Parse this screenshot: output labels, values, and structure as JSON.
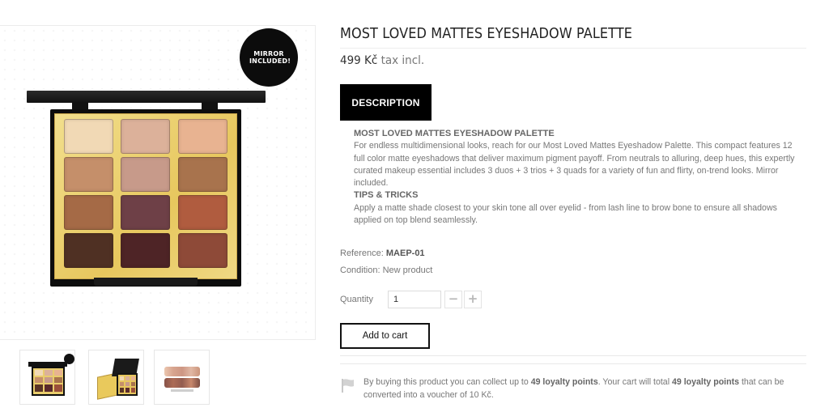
{
  "gallery": {
    "badge_text": "MIRROR INCLUDED!",
    "shade_colors": [
      "#f1d9b5",
      "#dcb19a",
      "#e8b391",
      "#c58f6a",
      "#c79a8a",
      "#a8734d",
      "#a56a46",
      "#6e4047",
      "#b05c3f",
      "#4f3023",
      "#4e2426",
      "#8e4a38"
    ],
    "thumbnails": [
      {
        "name": "thumbnail-palette-open"
      },
      {
        "name": "thumbnail-palette-box"
      },
      {
        "name": "thumbnail-swatches"
      }
    ]
  },
  "product": {
    "title": "MOST LOVED MATTES EYESHADOW PALETTE",
    "price": "499 Kč",
    "tax_label": "tax incl.",
    "tab_label": "DESCRIPTION",
    "description": {
      "heading": "MOST LOVED MATTES EYESHADOW PALETTE",
      "body": "For endless multidimensional looks, reach for our Most Loved Mattes Eyeshadow Palette. This compact features 12 full color matte eyeshadows that deliver maximum pigment payoff. From neutrals to alluring, deep hues, this expertly curated makeup essential includes 3 duos + 3 trios + 3 quads for a variety of fun and flirty, on-trend looks. Mirror included.",
      "tips_heading": "TIPS & TRICKS",
      "tips_body": "Apply a matte shade closest to your skin tone all over eyelid - from lash line to brow bone to ensure all shadows applied on top blend seamlessly."
    },
    "reference_label": "Reference:",
    "reference_value": "MAEP-01",
    "condition_label": "Condition:",
    "condition_value": "New product",
    "quantity_label": "Quantity",
    "quantity_value": "1",
    "minus_label": "−",
    "plus_label": "+",
    "add_to_cart_label": "Add to cart",
    "loyalty": {
      "part1": "By buying this product you can collect up to ",
      "points1": "49 loyalty points",
      "part2": ". Your cart will total ",
      "points2": "49 loyalty points",
      "part3": " that can be converted into a voucher of 10 Kč."
    }
  },
  "colors": {
    "accent": "#000000",
    "text_muted": "#777777"
  }
}
